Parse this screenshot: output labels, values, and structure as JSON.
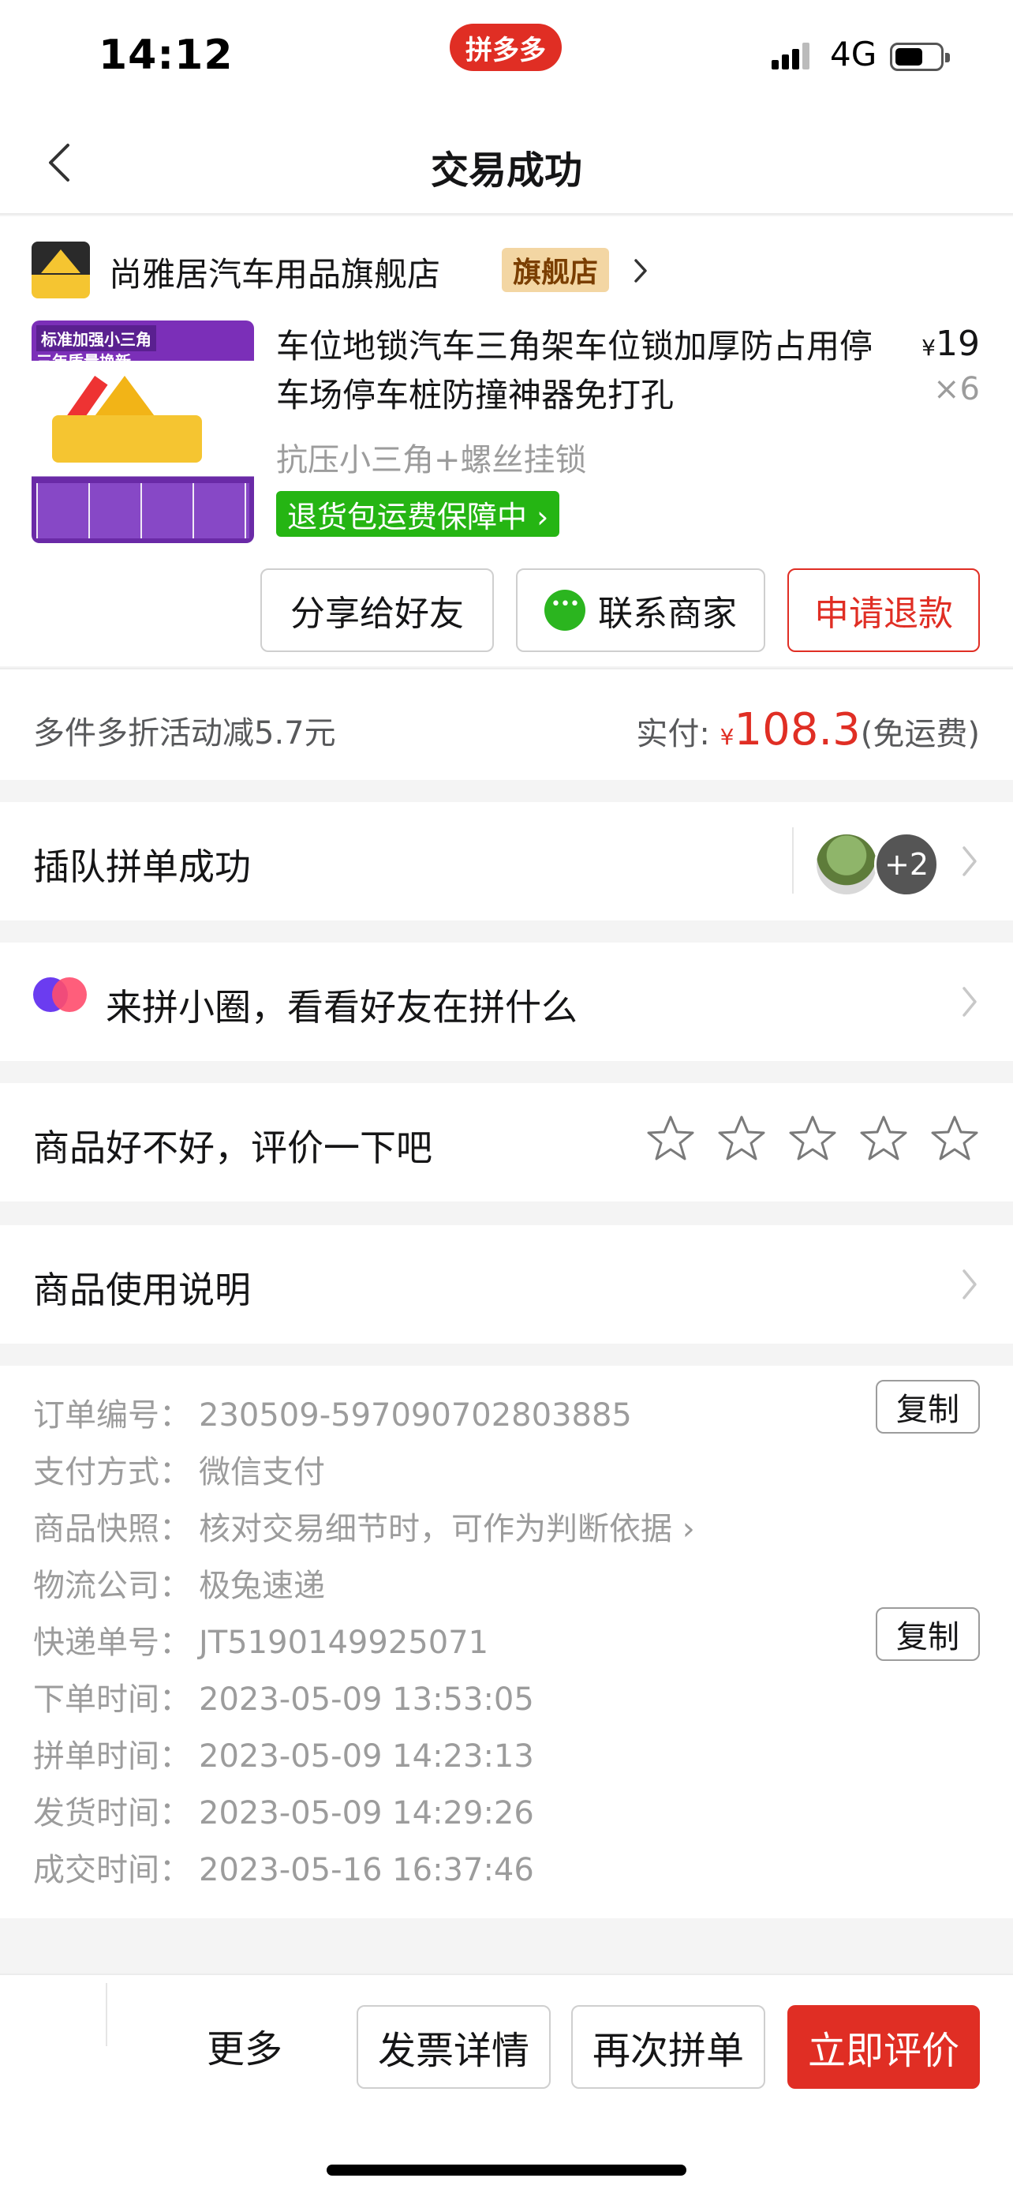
{
  "status_bar": {
    "time": "14:12",
    "app_badge": "拼多多",
    "network": "4G"
  },
  "nav": {
    "title": "交易成功"
  },
  "store": {
    "name": "尚雅居汽车用品旗舰店",
    "badge": "旗舰店"
  },
  "product": {
    "image_text_1": "标准加强小三角",
    "image_text_2": "三年质量换新",
    "title": "车位地锁汽车三角架车位锁加厚防占用停车场停车桩防撞神器免打孔",
    "price_currency": "¥",
    "price": "19",
    "quantity": "×6",
    "spec": "抗压小三角+螺丝挂锁",
    "guarantee": "退货包运费保障中 ›"
  },
  "order_actions": {
    "share": "分享给好友",
    "contact": "联系商家",
    "refund": "申请退款"
  },
  "discount": {
    "left_text": "多件多折活动减5.7元",
    "paid_label": "实付: ",
    "currency": "¥",
    "amount": "108.3",
    "shipping": "(免运费)"
  },
  "group": {
    "label": "插队拼单成功",
    "extra_count": "+2"
  },
  "circle": {
    "label": "来拼小圈，看看好友在拼什么"
  },
  "review": {
    "label": "商品好不好，评价一下吧",
    "rating": 0,
    "max_rating": 5
  },
  "manual": {
    "label": "商品使用说明"
  },
  "order_info": [
    {
      "key": "订单编号：",
      "value": "230509-597090702803885",
      "copy": "复制"
    },
    {
      "key": "支付方式：",
      "value": "微信支付"
    },
    {
      "key": "商品快照：",
      "value": "核对交易细节时，可作为判断依据 ›"
    },
    {
      "key": "物流公司：",
      "value": "极兔速递"
    },
    {
      "key": "快递单号：",
      "value": "JT5190149925071",
      "copy": "复制"
    },
    {
      "key": "下单时间：",
      "value": "2023-05-09 13:53:05"
    },
    {
      "key": "拼单时间：",
      "value": "2023-05-09 14:23:13"
    },
    {
      "key": "发货时间：",
      "value": "2023-05-09 14:29:26"
    },
    {
      "key": "成交时间：",
      "value": "2023-05-16 16:37:46"
    }
  ],
  "bottom_bar": {
    "more": "更多",
    "invoice": "发票详情",
    "reorder": "再次拼单",
    "review_now": "立即评价"
  },
  "colors": {
    "accent": "#e02e24",
    "green": "#25b513",
    "muted": "#9c9c9c"
  }
}
